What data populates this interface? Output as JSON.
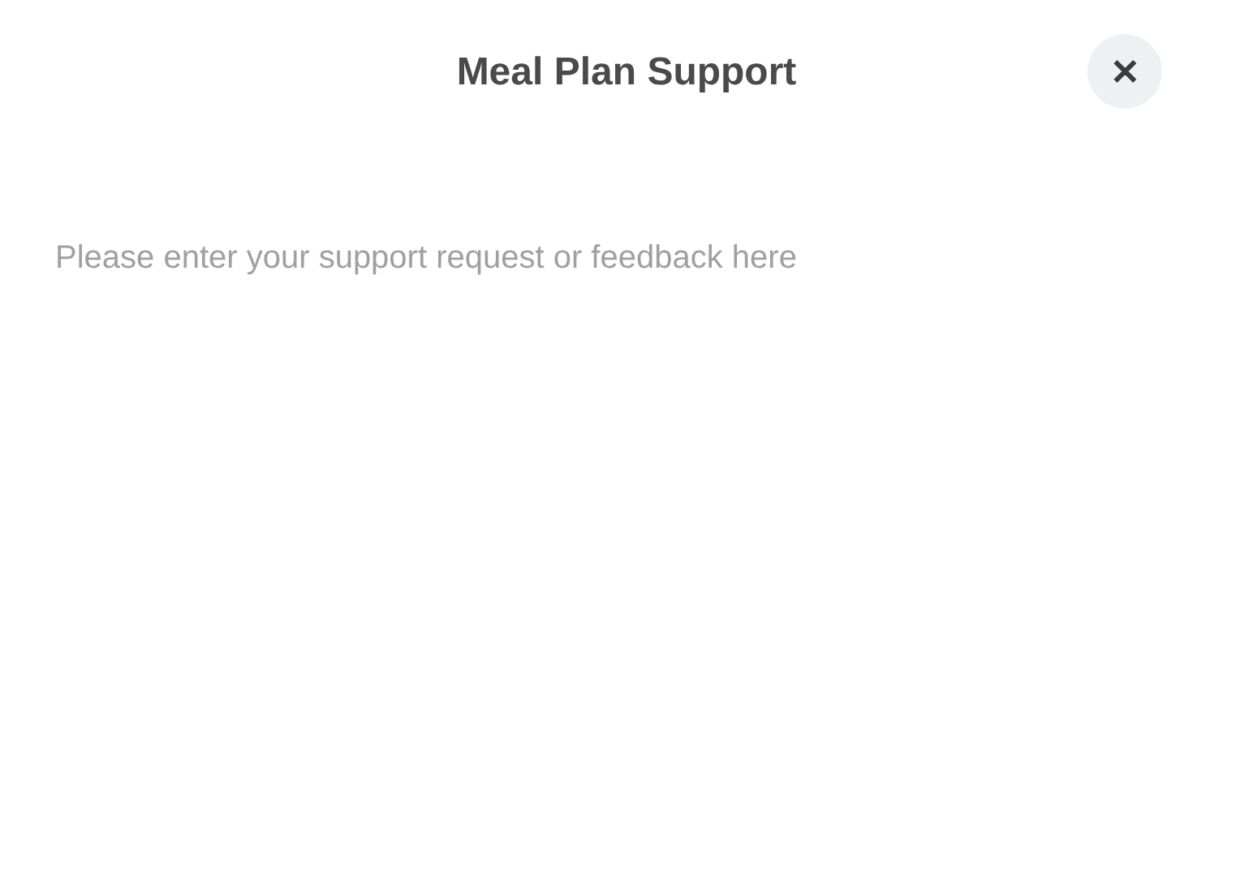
{
  "dialog": {
    "title": "Meal Plan Support",
    "close_icon": "✕"
  },
  "message": {
    "placeholder": "Please enter your support request or feedback here"
  }
}
